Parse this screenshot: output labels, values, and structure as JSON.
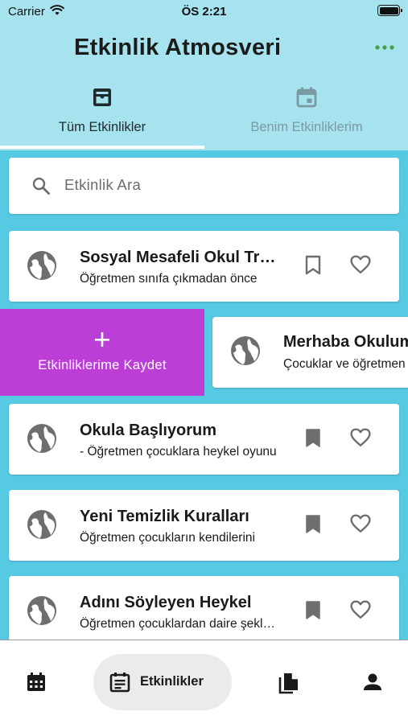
{
  "status_bar": {
    "carrier": "Carrier",
    "time": "ÖS 2:21"
  },
  "app": {
    "title": "Etkinlik Atmosveri"
  },
  "tabs": [
    {
      "label": "Tüm Etkinlikler",
      "icon": "inbox-icon",
      "active": true
    },
    {
      "label": "Benim Etkinliklerim",
      "icon": "event-calendar-icon",
      "active": false
    }
  ],
  "search": {
    "placeholder": "Etkinlik Ara"
  },
  "events": [
    {
      "title": "Sosyal Mesafeli Okul Trafiği",
      "description": "Öğretmen sınıfa çıkmadan önce",
      "bookmarked": false
    },
    {
      "title": "Okula Başlıyorum",
      "description": "- Öğretmen çocuklara heykel oyunu",
      "bookmarked": true
    },
    {
      "title": "Yeni Temizlik Kuralları",
      "description": "Öğretmen çocukların kendilerini",
      "bookmarked": true
    },
    {
      "title": "Adını Söyleyen Heykel",
      "description": "Öğretmen çocuklardan daire şeklinde",
      "bookmarked": true
    }
  ],
  "swiped_event": {
    "title": "Merhaba Okulum",
    "description": "Çocuklar ve öğretmen"
  },
  "swipe_action": {
    "label": "Etkinliklerime Kaydet",
    "icon": "plus-icon",
    "color": "#bb3fd6"
  },
  "bottom_nav": [
    {
      "icon": "calendar-icon",
      "label": ""
    },
    {
      "icon": "list-icon",
      "label": "Etkinlikler",
      "active": true
    },
    {
      "icon": "documents-icon",
      "label": ""
    },
    {
      "icon": "person-icon",
      "label": ""
    }
  ],
  "colors": {
    "background": "#56c9e3",
    "header": "#a6e3ee",
    "accent": "#bb3fd6",
    "menu_dots": "#43a047"
  }
}
